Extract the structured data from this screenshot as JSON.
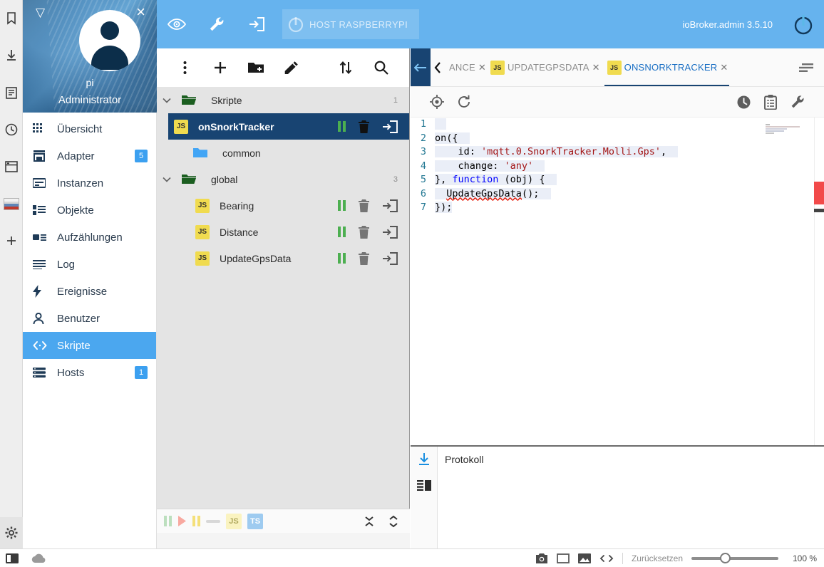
{
  "dock": {
    "items": [
      {
        "name": "bookmark-icon",
        "label": "Lesezeichen"
      },
      {
        "name": "download-icon",
        "label": "Downloads"
      },
      {
        "name": "reading-list-icon",
        "label": "Leseliste"
      },
      {
        "name": "history-icon",
        "label": "Verlauf"
      },
      {
        "name": "window-icon",
        "label": "Fenster"
      },
      {
        "name": "page-thumbnail",
        "label": "Seitenvorschau"
      },
      {
        "name": "add-icon",
        "label": "Hinzufügen"
      }
    ],
    "settings_label": "Einstellungen"
  },
  "sidebar": {
    "profile": {
      "close_label": "×",
      "logo": "▽",
      "user": "pi",
      "role": "Administrator"
    },
    "items": [
      {
        "label": "Übersicht",
        "icon": "grid-icon",
        "badge": "",
        "selected": false
      },
      {
        "label": "Adapter",
        "icon": "store-icon",
        "badge": "5",
        "selected": false
      },
      {
        "label": "Instanzen",
        "icon": "instances-icon",
        "badge": "",
        "selected": false
      },
      {
        "label": "Objekte",
        "icon": "objects-icon",
        "badge": "",
        "selected": false
      },
      {
        "label": "Aufzählungen",
        "icon": "enums-icon",
        "badge": "",
        "selected": false
      },
      {
        "label": "Log",
        "icon": "log-icon",
        "badge": "",
        "selected": false
      },
      {
        "label": "Ereignisse",
        "icon": "events-icon",
        "badge": "",
        "selected": false
      },
      {
        "label": "Benutzer",
        "icon": "users-icon",
        "badge": "",
        "selected": false
      },
      {
        "label": "Skripte",
        "icon": "code-icon",
        "badge": "",
        "selected": true
      },
      {
        "label": "Hosts",
        "icon": "hosts-icon",
        "badge": "1",
        "selected": false
      }
    ]
  },
  "topbar": {
    "eye_label": "Experten-Modus",
    "wrench_label": "Einstellungen",
    "login_label": "Abmelden",
    "host_button": "HOST RASPBERRYPI",
    "version": "ioBroker.admin 3.5.10",
    "power_label": "Neustart"
  },
  "tree": {
    "toolbar": {
      "more_label": "Mehr",
      "add_script_label": "Neues Skript",
      "add_folder_label": "Neuer Ordner",
      "edit_label": "Umbenennen",
      "expand_label": "Alle aus-/einklappen",
      "search_label": "Suchen"
    },
    "rows": [
      {
        "type": "folder",
        "label": "Skripte",
        "count": "1",
        "indent": 0,
        "color": "#1b5e20",
        "expanded": true
      },
      {
        "type": "script",
        "label": "onSnorkTracker",
        "badge": "JS",
        "indent": 1,
        "selected": true
      },
      {
        "type": "folder",
        "label": "common",
        "count": "",
        "indent": 1,
        "color": "#42a5f5",
        "expanded": false
      },
      {
        "type": "folder",
        "label": "global",
        "count": "3",
        "indent": 0,
        "color": "#1b5e20",
        "expanded": true
      },
      {
        "type": "script",
        "label": "Bearing",
        "badge": "JS",
        "indent": 2,
        "selected": false
      },
      {
        "type": "script",
        "label": "Distance",
        "badge": "JS",
        "indent": 2,
        "selected": false
      },
      {
        "type": "script",
        "label": "UpdateGpsData",
        "badge": "JS",
        "indent": 2,
        "selected": false
      }
    ],
    "row_actions": {
      "pause_label": "Pause",
      "delete_label": "Löschen",
      "export_label": "Exportieren"
    },
    "footer": {
      "pause_all_label": "Alle pausieren",
      "run_label": "Starten",
      "pause_label": "Pausieren",
      "debug_label": "Debug",
      "js_chip": "JS",
      "ts_chip": "TS",
      "collapse_label": "Einklappen",
      "expand_label": "Ausklappen"
    }
  },
  "editor": {
    "back_label": "Zurück",
    "scroll_left_label": "Tabs nach links",
    "tabs": [
      {
        "label": "ANCE",
        "badge": "",
        "active": false,
        "clipped": true
      },
      {
        "label": "UPDATEGPSDATA",
        "badge": "JS",
        "active": false,
        "clipped": false
      },
      {
        "label": "ONSNORKTRACKER",
        "badge": "JS",
        "active": true,
        "clipped": false
      }
    ],
    "tab_close": "✕",
    "menu_label": "Tab-Liste",
    "toolbar": {
      "locate_label": "Im Baum anzeigen",
      "reload_label": "Neu laden",
      "cron_label": "CRON",
      "clipboard_label": "Vorlagen",
      "settings_label": "Einstellungen"
    },
    "code_lines": [
      {
        "n": "1",
        "parts": [
          {
            "t": "",
            "c": ""
          }
        ]
      },
      {
        "n": "2",
        "parts": [
          {
            "t": "on({",
            "c": ""
          }
        ]
      },
      {
        "n": "3",
        "parts": [
          {
            "t": "    id: ",
            "c": ""
          },
          {
            "t": "'mqtt.0.SnorkTracker.Molli.Gps'",
            "c": "tok-str"
          },
          {
            "t": ",",
            "c": ""
          }
        ]
      },
      {
        "n": "4",
        "parts": [
          {
            "t": "    change: ",
            "c": ""
          },
          {
            "t": "'any'",
            "c": "tok-str"
          }
        ]
      },
      {
        "n": "5",
        "parts": [
          {
            "t": "}, ",
            "c": ""
          },
          {
            "t": "function",
            "c": "tok-kw"
          },
          {
            "t": " (obj) {",
            "c": ""
          }
        ]
      },
      {
        "n": "6",
        "parts": [
          {
            "t": "  UpdateGpsData",
            "c": "squiggle"
          },
          {
            "t": "();",
            "c": ""
          }
        ]
      },
      {
        "n": "7",
        "parts": [
          {
            "t": "});",
            "c": ""
          }
        ]
      }
    ]
  },
  "protocol": {
    "title": "Protokoll",
    "download_label": "Herunterladen",
    "layout_label": "Ansicht umschalten"
  },
  "statusbar": {
    "taskbar_label": "Fensterliste",
    "cloud_label": "Cloud",
    "camera_label": "Screenshot",
    "frame_label": "Rahmen",
    "image_label": "Bild",
    "code_label": "Quelltext",
    "reset_label": "Zurücksetzen",
    "zoom_value": "100 %"
  },
  "colors": {
    "accent": "#66b3ee",
    "selected_row": "#184472",
    "sidebar_selected": "#4ba7ef",
    "badge": "#3ca0f0",
    "js_badge": "#f0db4f",
    "error": "#e51400"
  }
}
